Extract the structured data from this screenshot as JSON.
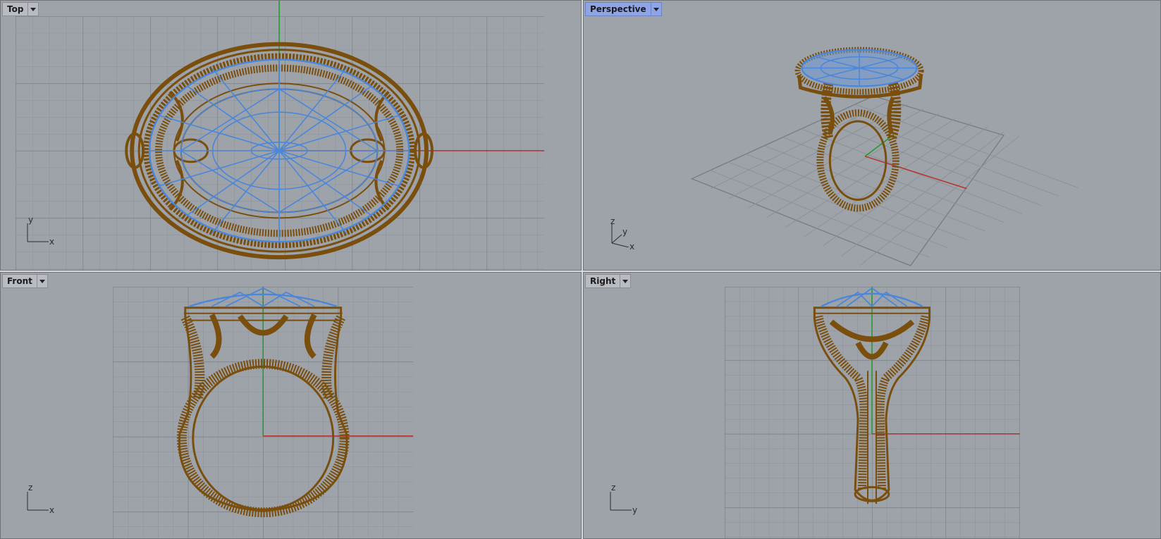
{
  "colors": {
    "viewport_bg": "#9ea3aa",
    "grid_minor": "#8c9198",
    "grid_major": "#767b82",
    "axis_x": "#b5332e",
    "axis_y": "#1f9a2a",
    "wire_metal": "#7a4e0c",
    "wire_gem": "#4a86d9",
    "active_tab": "#8fa4e6"
  },
  "viewports": [
    {
      "id": "top",
      "title": "Top",
      "active": false,
      "axes": [
        "y",
        "x"
      ],
      "icon": "dropdown-arrow-icon"
    },
    {
      "id": "perspective",
      "title": "Perspective",
      "active": true,
      "axes": [
        "z",
        "y",
        "x"
      ],
      "icon": "dropdown-arrow-icon"
    },
    {
      "id": "front",
      "title": "Front",
      "active": false,
      "axes": [
        "z",
        "x"
      ],
      "icon": "dropdown-arrow-icon"
    },
    {
      "id": "right",
      "title": "Right",
      "active": false,
      "axes": [
        "z",
        "y"
      ],
      "icon": "dropdown-arrow-icon"
    }
  ]
}
